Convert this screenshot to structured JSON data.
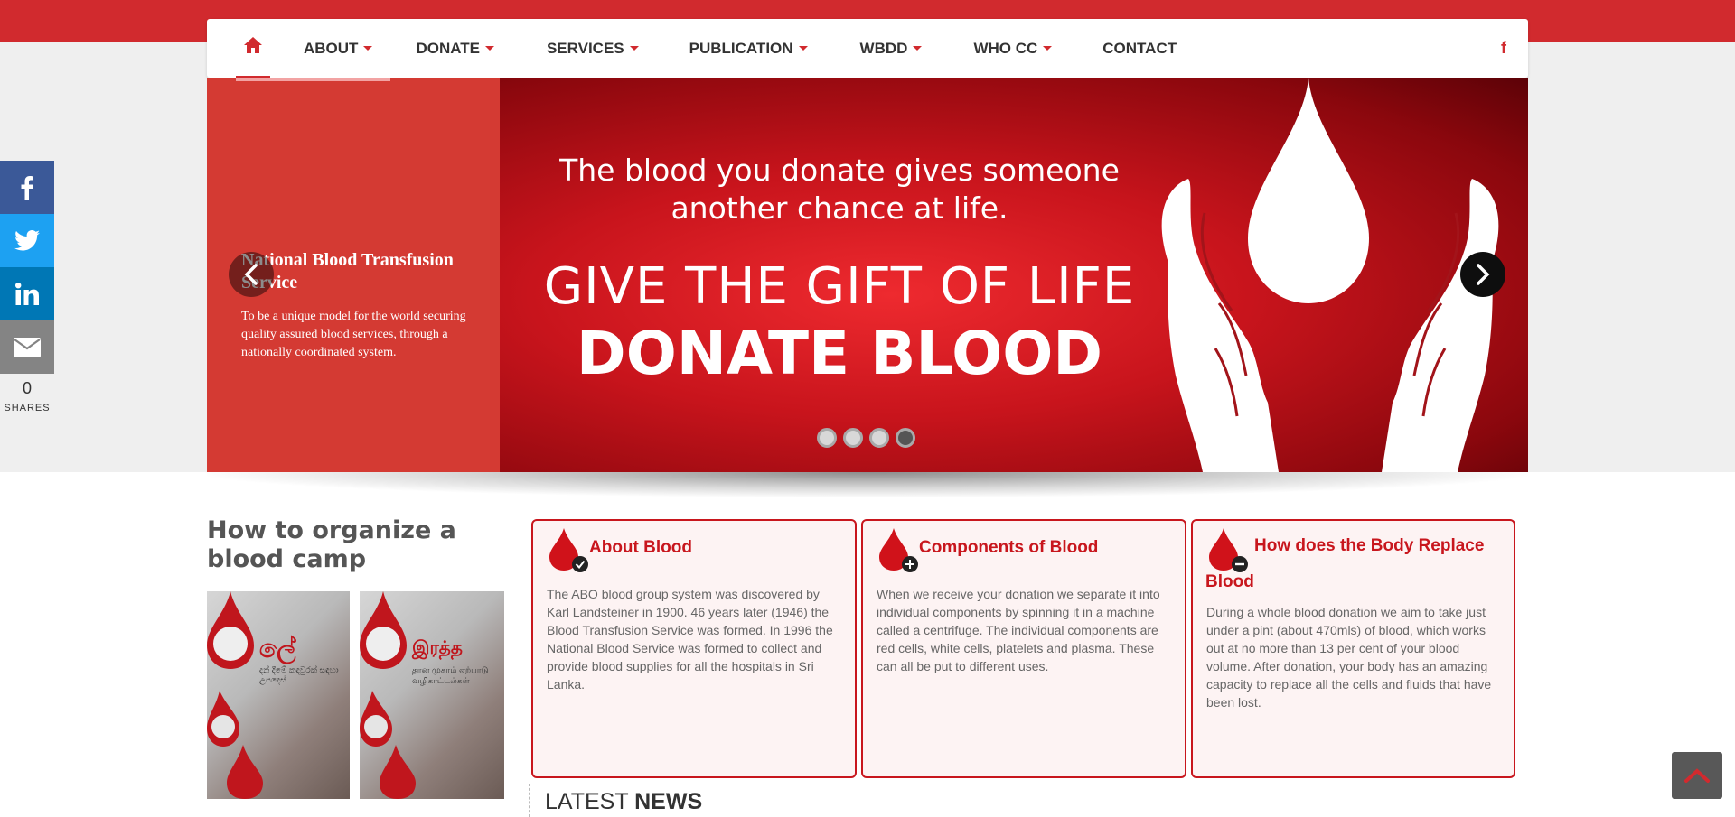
{
  "nav": {
    "items": [
      {
        "label": "ABOUT",
        "has_dropdown": true
      },
      {
        "label": "DONATE",
        "has_dropdown": true
      },
      {
        "label": "SERVICES",
        "has_dropdown": true
      },
      {
        "label": "PUBLICATION",
        "has_dropdown": true
      },
      {
        "label": "WBDD",
        "has_dropdown": true
      },
      {
        "label": "WHO CC",
        "has_dropdown": true
      },
      {
        "label": "CONTACT",
        "has_dropdown": false
      }
    ],
    "facebook_label": "f",
    "home_icon": "home-icon"
  },
  "slider": {
    "caption_title": "National Blood Transfusion Service",
    "caption_text": "To be a unique model for the world securing quality assured blood services, through a nationally coordinated system.",
    "banner_tagline_1": "The blood you donate gives someone",
    "banner_tagline_2": "another chance at life.",
    "banner_heading": "GIVE THE GIFT OF LIFE",
    "banner_cta": "DONATE BLOOD",
    "slide_count": 4,
    "active_slide": 4
  },
  "social": {
    "share_count": "0",
    "share_label": "SHARES",
    "buttons": [
      "facebook-icon",
      "twitter-icon",
      "linkedin-icon",
      "email-icon"
    ]
  },
  "camp": {
    "title": "How to organize a blood camp",
    "poster_1_heading": "ලේ",
    "poster_1_sub": "දන් දීමේ කඳවුරක් සඳහා උපදෙස්",
    "poster_2_heading": "இரத்த",
    "poster_2_sub": "தான முகாம் ஏற்பாடு வழிகாட்டல்கள்"
  },
  "info": [
    {
      "title": "About Blood",
      "badge": "check",
      "text": "The ABO blood group system was discovered by Karl Landsteiner in 1900. 46 years later (1946) the Blood Transfusion Service was formed. In 1996 the National Blood Service was formed to collect and provide blood supplies for all the hospitals in Sri Lanka."
    },
    {
      "title": "Components of Blood",
      "badge": "plus",
      "text": "When we receive your donation we separate it into individual components by spinning it in a machine called a centrifuge. The individual components are red cells, white cells, platelets and plasma. These can all be put to different uses."
    },
    {
      "title": "How does the Body Replace Blood",
      "badge": "minus",
      "text": "During a whole blood donation we aim to take just under a pint (about 470mls) of blood, which works out at no more than 13 per cent of your blood volume. After donation, your body has an amazing capacity to replace all the cells and fluids that have been lost."
    }
  ],
  "news": {
    "title_light": "LATEST",
    "title_bold": "NEWS"
  },
  "colors": {
    "brand_red": "#d12a2e",
    "box_red": "#c8161d",
    "facebook": "#3b5998",
    "twitter": "#1da1f2",
    "linkedin": "#0077b5",
    "email": "#848484"
  }
}
